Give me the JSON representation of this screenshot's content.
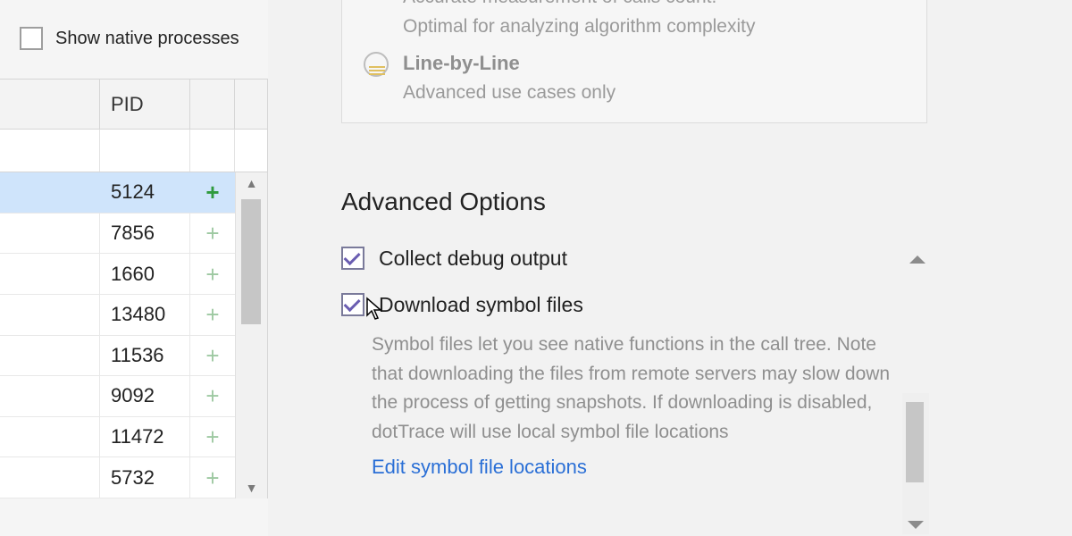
{
  "left": {
    "show_native_label": "Show native processes",
    "header_pid": "PID",
    "rows": [
      {
        "pid": "5124",
        "selected": true
      },
      {
        "pid": "7856",
        "selected": false
      },
      {
        "pid": "1660",
        "selected": false
      },
      {
        "pid": "13480",
        "selected": false
      },
      {
        "pid": "11536",
        "selected": false
      },
      {
        "pid": "9092",
        "selected": false
      },
      {
        "pid": "11472",
        "selected": false
      },
      {
        "pid": "5732",
        "selected": false
      }
    ]
  },
  "modes": {
    "tracing_sub1": "Accurate measurement of calls count.",
    "tracing_sub2": "Optimal for analyzing algorithm complexity",
    "lbl_title": "Line-by-Line",
    "lbl_sub": "Advanced use cases only"
  },
  "advanced": {
    "title": "Advanced Options",
    "collect_label": "Collect debug output",
    "download_label": "Download symbol files",
    "download_desc": "Symbol files let you see native functions in the call tree. Note that downloading the files from remote servers may slow down the process of getting snapshots. If downloading is disabled, dotTrace will use local symbol file locations",
    "edit_link": "Edit symbol file locations"
  }
}
